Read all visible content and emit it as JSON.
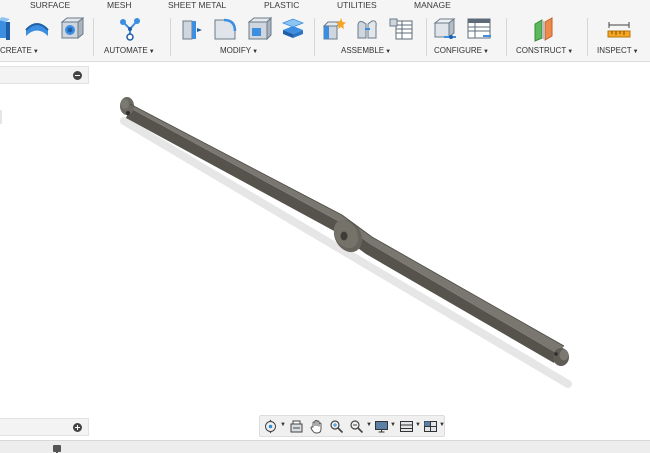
{
  "tabs": [
    "SURFACE",
    "MESH",
    "SHEET METAL",
    "PLASTIC",
    "UTILITIES",
    "MANAGE"
  ],
  "ribbon": {
    "groups": [
      {
        "label": "CREATE",
        "icons": [
          "extrude-icon",
          "revolve-icon",
          "hole-icon"
        ]
      },
      {
        "label": "AUTOMATE",
        "icons": [
          "automate-icon"
        ]
      },
      {
        "label": "MODIFY",
        "icons": [
          "press-pull-icon",
          "fillet-icon",
          "shell-icon",
          "combine-icon"
        ]
      },
      {
        "label": "ASSEMBLE",
        "icons": [
          "new-component-icon",
          "joint-icon",
          "bill-of-materials-icon"
        ]
      },
      {
        "label": "CONFIGURE",
        "icons": [
          "configure-icon",
          "configuration-table-icon"
        ]
      },
      {
        "label": "CONSTRUCT",
        "icons": [
          "offset-plane-icon"
        ]
      },
      {
        "label": "INSPECT",
        "icons": [
          "measure-icon"
        ]
      }
    ]
  },
  "browser": {
    "collapse_icon": "collapse-icon",
    "expand_icon": "expand-icon"
  },
  "navbar": {
    "icons": [
      "orbit-icon",
      "look-at-icon",
      "pan-icon",
      "zoom-icon",
      "zoom-window-icon",
      "display-settings-icon",
      "grid-settings-icon",
      "viewports-icon"
    ]
  },
  "colors": {
    "model": "#66645d",
    "model_top": "#7b7a72",
    "accent_blue": "#2d8fd8",
    "ribbon_bg": "#f5f5f5"
  }
}
